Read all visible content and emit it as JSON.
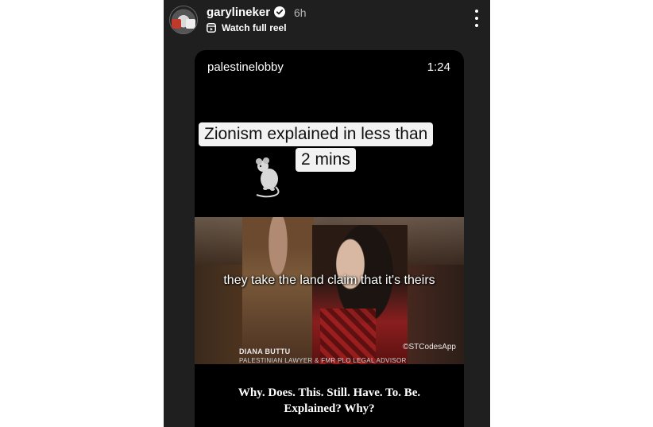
{
  "story": {
    "username": "garylineker",
    "time_ago": "6h",
    "watch_reel_label": "Watch full reel"
  },
  "video": {
    "source_user": "palestinelobby",
    "duration": "1:24",
    "title_line1": "Zionism explained in less than",
    "title_line2": "2 mins",
    "subtitle": "they take the land claim that it's theirs",
    "lower_third_name": "DIANA BUTTU",
    "lower_third_role": "PALESTINIAN LAWYER & FMR PLO LEGAL ADVISOR",
    "watermark": "©STCodesApp",
    "caption_line1": "Why. Does. This. Still. Have. To. Be.",
    "caption_line2": "Explained? Why?"
  },
  "icons": {
    "verified": "verified-badge-icon",
    "reel": "reel-icon",
    "more": "more-options-icon",
    "sticker": "rat-sticker-icon"
  },
  "colors": {
    "story_background": "#1f1f1f",
    "video_background": "#000000",
    "title_box": "#f2f2f2"
  }
}
